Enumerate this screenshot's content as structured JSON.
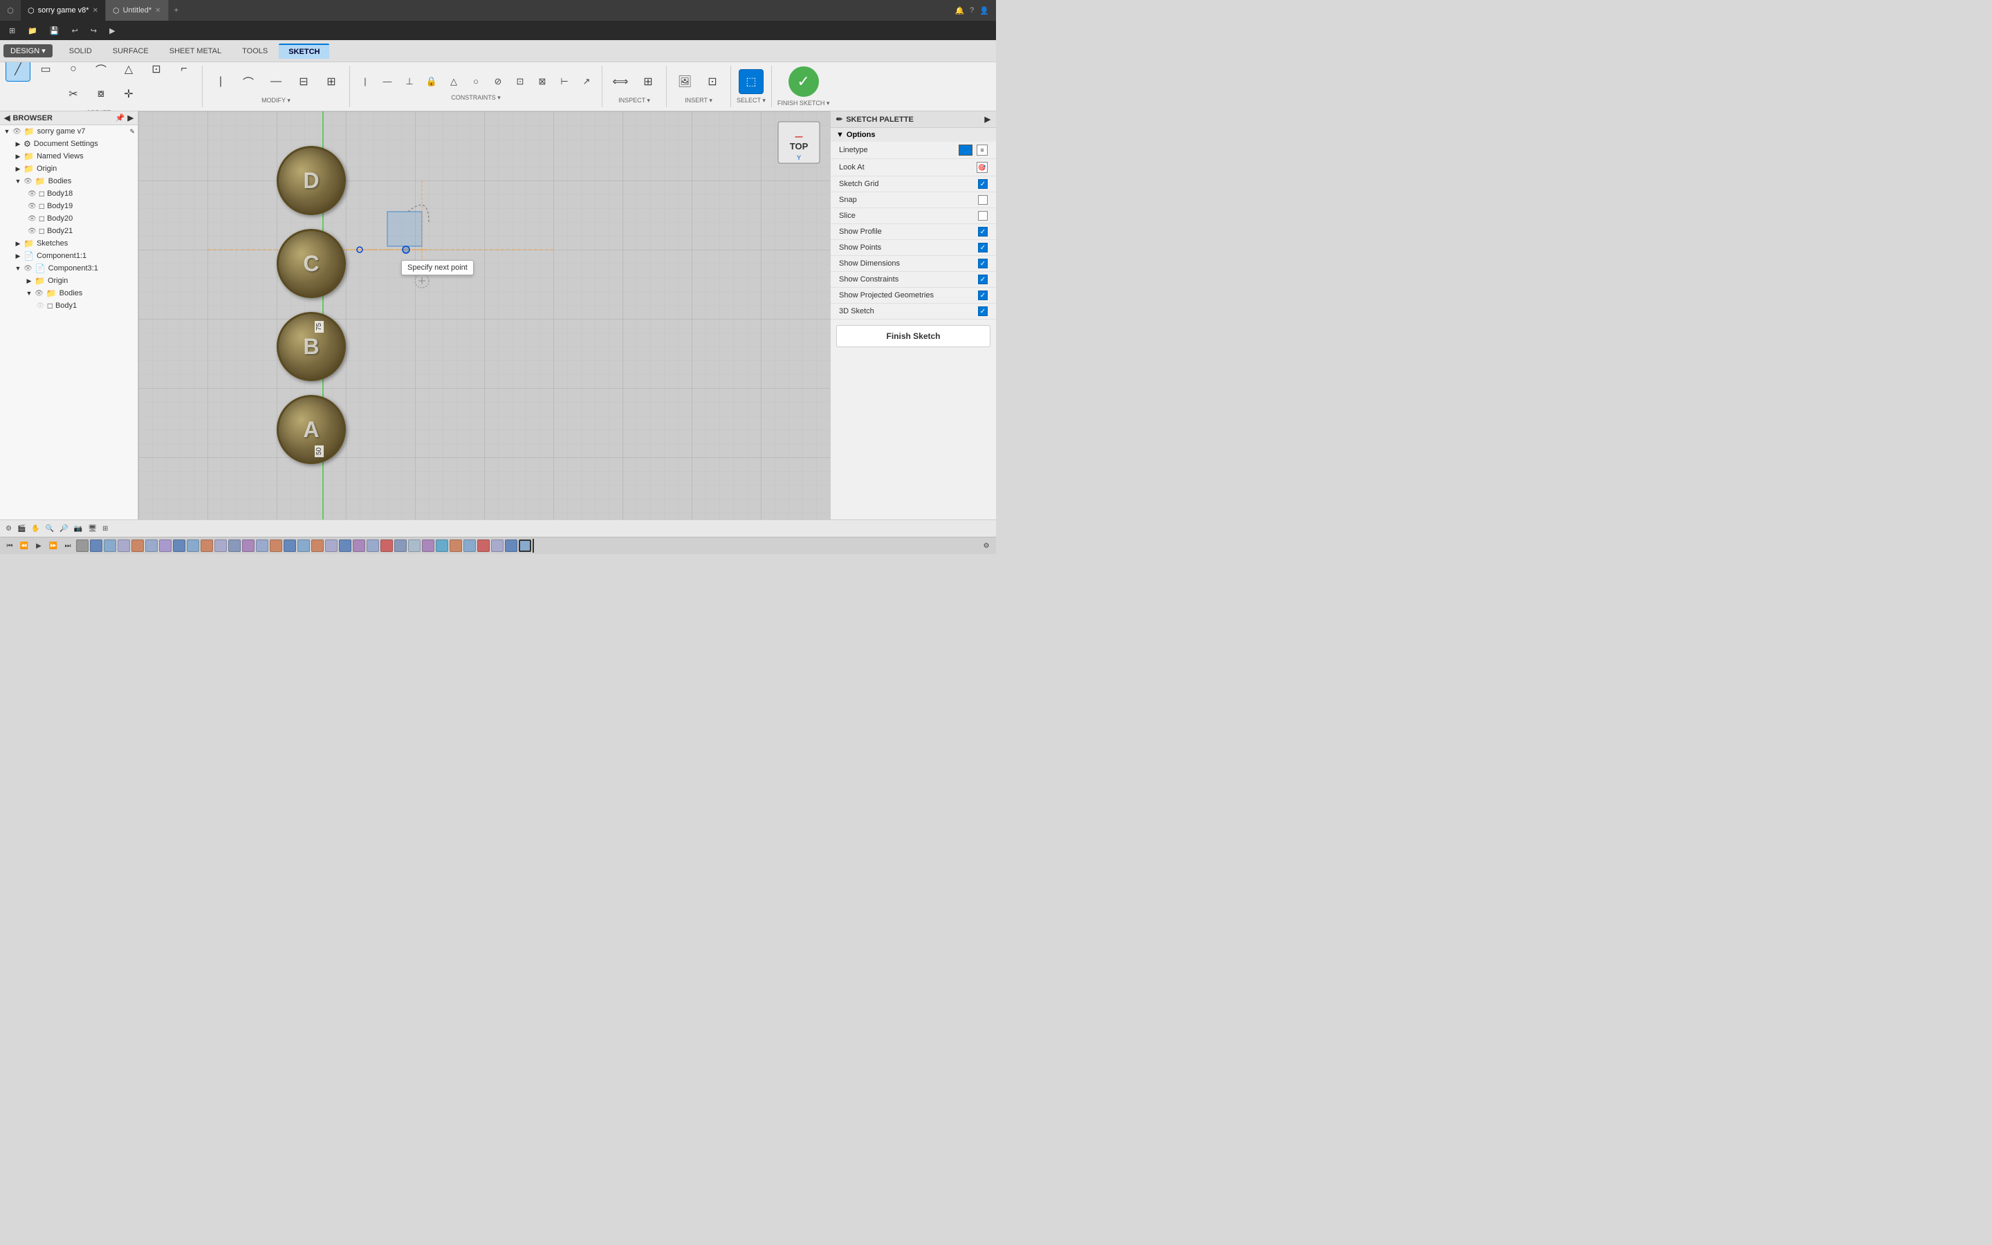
{
  "titlebar": {
    "app_icon": "⬡",
    "tabs": [
      {
        "label": "sorry game v8*",
        "active": true
      },
      {
        "label": "Untitled*",
        "active": false
      }
    ],
    "add_tab_icon": "+",
    "right_icons": [
      "🔔",
      "?",
      "👤"
    ]
  },
  "menubar": {
    "items": [
      "⊞",
      "📁",
      "💾",
      "↩",
      "↪",
      "▶"
    ]
  },
  "toolbar": {
    "design_label": "DESIGN ▾",
    "tabs": [
      "SOLID",
      "SURFACE",
      "SHEET METAL",
      "TOOLS",
      "SKETCH"
    ],
    "active_tab": "SKETCH",
    "groups": [
      {
        "label": "CREATE ▾",
        "tools": [
          "line",
          "rect",
          "circle",
          "arc",
          "polygon",
          "slot",
          "fillet",
          "trim",
          "offset",
          "move"
        ]
      },
      {
        "label": "MODIFY ▾",
        "tools": [
          "trim2",
          "offset2",
          "move2",
          "scale"
        ]
      },
      {
        "label": "CONSTRAINTS ▾",
        "tools": [
          "vert",
          "horiz",
          "perp",
          "tang",
          "eq",
          "parallel",
          "fix",
          "symm",
          "midpt",
          "concen",
          "collin",
          "smooth"
        ]
      },
      {
        "label": "INSPECT ▾",
        "tools": [
          "measure",
          "setref"
        ]
      },
      {
        "label": "INSERT ▾",
        "tools": [
          "image",
          "canvas"
        ]
      },
      {
        "label": "SELECT ▾",
        "tools": [
          "select"
        ]
      }
    ],
    "finish_sketch_label": "FINISH SKETCH ▾"
  },
  "browser": {
    "header": "BROWSER",
    "tree": [
      {
        "level": 0,
        "icon": "📁",
        "label": "sorry game v7",
        "expanded": true,
        "has_arrow": true,
        "eye": true
      },
      {
        "level": 1,
        "icon": "⚙",
        "label": "Document Settings",
        "expanded": false,
        "has_arrow": true
      },
      {
        "level": 1,
        "icon": "📁",
        "label": "Named Views",
        "expanded": false,
        "has_arrow": true
      },
      {
        "level": 1,
        "icon": "📁",
        "label": "Origin",
        "expanded": false,
        "has_arrow": true
      },
      {
        "level": 1,
        "icon": "📁",
        "label": "Bodies",
        "expanded": true,
        "has_arrow": true,
        "eye": true
      },
      {
        "level": 2,
        "icon": "□",
        "label": "Body18",
        "has_arrow": false,
        "eye": true
      },
      {
        "level": 2,
        "icon": "□",
        "label": "Body19",
        "has_arrow": false,
        "eye": true
      },
      {
        "level": 2,
        "icon": "□",
        "label": "Body20",
        "has_arrow": false,
        "eye": true
      },
      {
        "level": 2,
        "icon": "□",
        "label": "Body21",
        "has_arrow": false,
        "eye": true
      },
      {
        "level": 1,
        "icon": "📁",
        "label": "Sketches",
        "expanded": false,
        "has_arrow": true
      },
      {
        "level": 1,
        "icon": "📄",
        "label": "Component1:1",
        "expanded": false,
        "has_arrow": true
      },
      {
        "level": 1,
        "icon": "📄",
        "label": "Component3:1",
        "expanded": true,
        "has_arrow": true,
        "eye": true
      },
      {
        "level": 2,
        "icon": "📁",
        "label": "Origin",
        "expanded": false,
        "has_arrow": true
      },
      {
        "level": 2,
        "icon": "📁",
        "label": "Bodies",
        "expanded": true,
        "has_arrow": true,
        "eye": true
      },
      {
        "level": 3,
        "icon": "□",
        "label": "Body1",
        "has_arrow": false,
        "eye": false
      }
    ]
  },
  "canvas": {
    "background_color": "#cccccc",
    "tooltip": "Specify next point",
    "dim_labels": [
      "75",
      "50"
    ],
    "grid_color": "#bbbbbb"
  },
  "sketch_palette": {
    "header": "SKETCH PALETTE",
    "sections": [
      {
        "label": "Options",
        "expanded": true,
        "rows": [
          {
            "label": "Linetype",
            "type": "color",
            "checked": null
          },
          {
            "label": "Look At",
            "type": "action",
            "checked": null
          },
          {
            "label": "Sketch Grid",
            "type": "checkbox",
            "checked": true
          },
          {
            "label": "Snap",
            "type": "checkbox",
            "checked": false
          },
          {
            "label": "Slice",
            "type": "checkbox",
            "checked": false
          },
          {
            "label": "Show Profile",
            "type": "checkbox",
            "checked": true
          },
          {
            "label": "Show Points",
            "type": "checkbox",
            "checked": true
          },
          {
            "label": "Show Dimensions",
            "type": "checkbox",
            "checked": true
          },
          {
            "label": "Show Constraints",
            "type": "checkbox",
            "checked": true
          },
          {
            "label": "Show Projected Geometries",
            "type": "checkbox",
            "checked": true
          },
          {
            "label": "3D Sketch",
            "type": "checkbox",
            "checked": true
          }
        ]
      }
    ],
    "finish_sketch_label": "Finish Sketch"
  },
  "status_bar": {
    "items": [
      "🔲",
      "⬜",
      "🔲",
      "⬜",
      "⬜",
      "🔍",
      "📷",
      "🔲"
    ]
  },
  "timeline": {
    "nav_buttons": [
      "⏮",
      "⏪",
      "▶",
      "⏩",
      "⏭"
    ],
    "items": []
  },
  "viewport": {
    "cube_label": "TOP",
    "y_label": "Y"
  },
  "coins": [
    {
      "letter": "D",
      "top": "140",
      "left": "430"
    },
    {
      "letter": "C",
      "top": "255",
      "left": "430"
    },
    {
      "letter": "B",
      "top": "370",
      "left": "430"
    },
    {
      "letter": "A",
      "top": "480",
      "left": "430"
    }
  ]
}
